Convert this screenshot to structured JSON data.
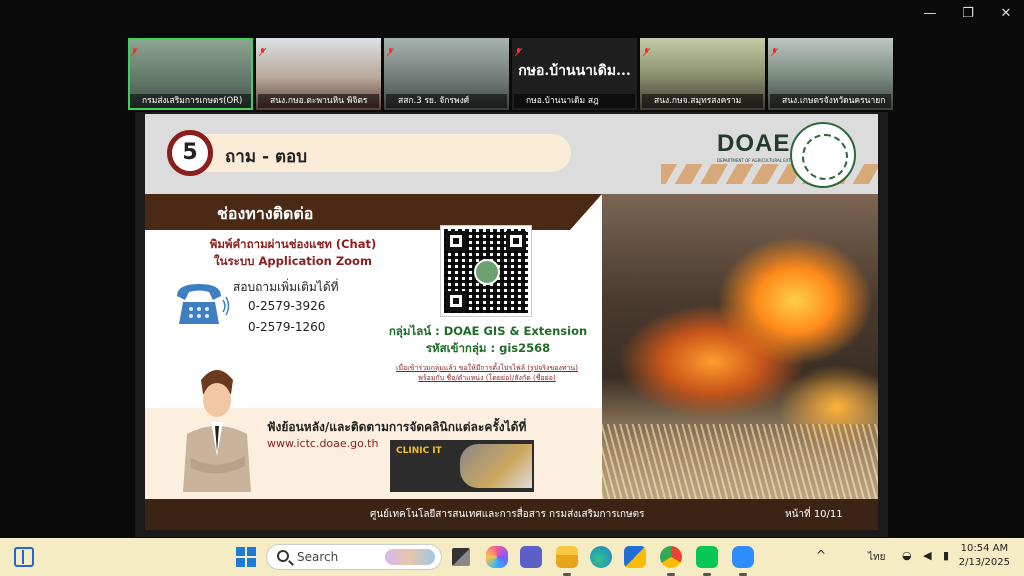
{
  "participants": [
    {
      "name": "กรมส่งเสริมการเกษตร(OR)",
      "active": true,
      "bg": "#6f8a78"
    },
    {
      "name": "สนง.กษอ.ตะพานหิน พิจิตร",
      "active": false,
      "bg": "#c9d3da"
    },
    {
      "name": "สสก.3 รย. จักรพงศ์",
      "active": false,
      "bg": "#7d8a88"
    },
    {
      "name": "กษอ.บ้านนาเดิม สฎ",
      "active": false,
      "bg": "#1f1f1f",
      "big_label": "กษอ.บ้านนาเดิม..."
    },
    {
      "name": "สนง.กษจ.สมุทรสงคราม",
      "active": false,
      "bg": "#9aa38a"
    },
    {
      "name": "สนง.เกษตรจังหวัดนครนายก",
      "active": false,
      "bg": "#6b7a70"
    }
  ],
  "window_controls": {
    "minimize": "—",
    "restore": "❐",
    "close": "✕"
  },
  "slide": {
    "number": "5",
    "title": "ถาม - ตอบ",
    "logo": "DOAE",
    "logo_sub": "DEPARTMENT OF AGRICULTURAL EXTENSION",
    "section": "ช่องทางติดต่อ",
    "chat_line1": "พิมพ์คำถามผ่านช่องแชท (Chat)",
    "chat_line2": "ในระบบ Application Zoom",
    "ask_more": "สอบถามเพิ่มเติมได้ที่",
    "tel1": "0-2579-3926",
    "tel2": "0-2579-1260",
    "line_group": "กลุ่มไลน์ : DOAE GIS & Extension",
    "group_code": "รหัสเข้ากลุ่ม : gis2568",
    "note1": "เมื่อเข้าร่วมกลุ่มแล้ว ขอให้มีการตั้งโปรไฟล์ (รูปจริงของท่าน)",
    "note2": "พร้อมกับ ชื่อ/ตำแหน่ง (โดยย่อ)/สังกัด (ชื่อย่อ)",
    "watch_back": "ฟังย้อนหลัง/และติดตามการจัดคลินิกแต่ละครั้งได้ที่",
    "url": "www.ictc.doae.go.th",
    "clinic_label": "CLINIC IT",
    "footer": "ศูนย์เทคโนโลยีสารสนเทศและการสื่อสาร กรมส่งเสริมการเกษตร",
    "page": "หน้าที่ 10/11"
  },
  "taskbar": {
    "search_placeholder": "Search",
    "ime": "ไทย",
    "time": "10:54 AM",
    "date": "2/13/2025",
    "apps": [
      "file-explorer",
      "copilot",
      "teams",
      "folder",
      "edge",
      "store",
      "chrome",
      "line",
      "zoom"
    ]
  }
}
